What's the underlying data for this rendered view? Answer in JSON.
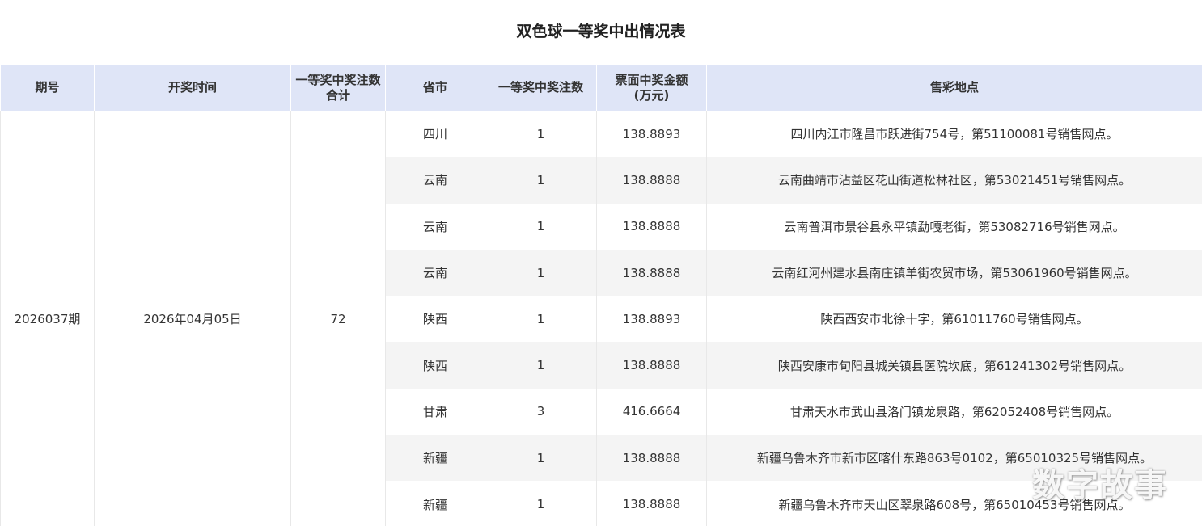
{
  "title": "双色球一等奖中出情况表",
  "headers": {
    "period": "期号",
    "draw_time": "开奖时间",
    "total_bets_line1": "一等奖中奖注数",
    "total_bets_line2": "合计",
    "province": "省市",
    "bets": "一等奖中奖注数",
    "amount_line1": "票面中奖金额",
    "amount_line2": "(万元)",
    "location": "售彩地点"
  },
  "summary": {
    "period": "2026037期",
    "draw_time": "2026年04月05日",
    "total_bets": "72"
  },
  "rows": [
    {
      "province": "四川",
      "bets": "1",
      "amount": "138.8893",
      "location": "四川内江市隆昌市跃进街754号，第51100081号销售网点。"
    },
    {
      "province": "云南",
      "bets": "1",
      "amount": "138.8888",
      "location": "云南曲靖市沾益区花山街道松林社区，第53021451号销售网点。"
    },
    {
      "province": "云南",
      "bets": "1",
      "amount": "138.8888",
      "location": "云南普洱市景谷县永平镇勐嘎老街，第53082716号销售网点。"
    },
    {
      "province": "云南",
      "bets": "1",
      "amount": "138.8888",
      "location": "云南红河州建水县南庄镇羊街农贸市场，第53061960号销售网点。"
    },
    {
      "province": "陕西",
      "bets": "1",
      "amount": "138.8893",
      "location": "陕西西安市北徐十字，第61011760号销售网点。"
    },
    {
      "province": "陕西",
      "bets": "1",
      "amount": "138.8888",
      "location": "陕西安康市旬阳县城关镇县医院坎底，第61241302号销售网点。"
    },
    {
      "province": "甘肃",
      "bets": "3",
      "amount": "416.6664",
      "location": "甘肃天水市武山县洛门镇龙泉路，第62052408号销售网点。"
    },
    {
      "province": "新疆",
      "bets": "1",
      "amount": "138.8888",
      "location": "新疆乌鲁木齐市新市区喀什东路863号0102，第65010325号销售网点。"
    },
    {
      "province": "新疆",
      "bets": "1",
      "amount": "138.8888",
      "location": "新疆乌鲁木齐市天山区翠泉路608号，第65010453号销售网点。"
    }
  ],
  "watermark": "数字故事"
}
